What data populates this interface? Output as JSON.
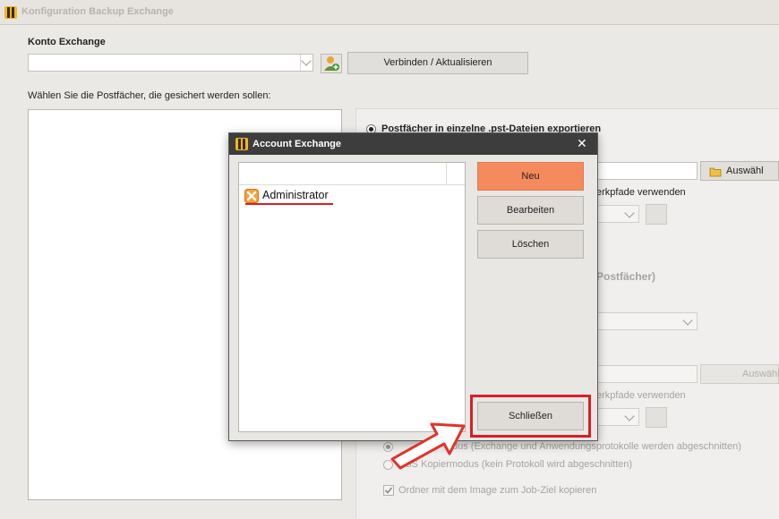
{
  "window": {
    "title": "Konfiguration Backup Exchange"
  },
  "account": {
    "label": "Konto Exchange",
    "combo_value": "",
    "connect_button": "Verbinden / Aktualisieren"
  },
  "mailboxes": {
    "label": "Wählen Sie die Postfächer, die gesichert werden sollen:"
  },
  "export": {
    "option_pst": "Postfächer in einzelne .pst-Dateien exportieren",
    "browse_button": "Auswähl",
    "network_paths": "erkpfade verwenden",
    "section_suffix": "Postfächer)",
    "browse_button_2": "Auswähl",
    "network_paths_2": "erkpfade verwenden",
    "option_mode_1": "dus (Exchange und Anwendungsprotokolle werden abgeschnitten)",
    "option_vss": "VSS Kopiermodus (kein Protokoll wird abgeschnitten)",
    "copy_folder": "Ordner mit dem Image zum Job-Ziel kopieren"
  },
  "dialog": {
    "title": "Account Exchange",
    "close": "✕",
    "accounts": [
      {
        "name": "Administrator",
        "icon": "account-icon"
      }
    ],
    "buttons": {
      "new": "Neu",
      "edit": "Bearbeiten",
      "delete": "Löschen",
      "close": "Schließen"
    }
  },
  "colors": {
    "dialog_titlebar": "#3d3d3d",
    "primary_button": "#f58a5e",
    "highlight_red": "#d81f26",
    "underline_red": "#d81f26"
  }
}
